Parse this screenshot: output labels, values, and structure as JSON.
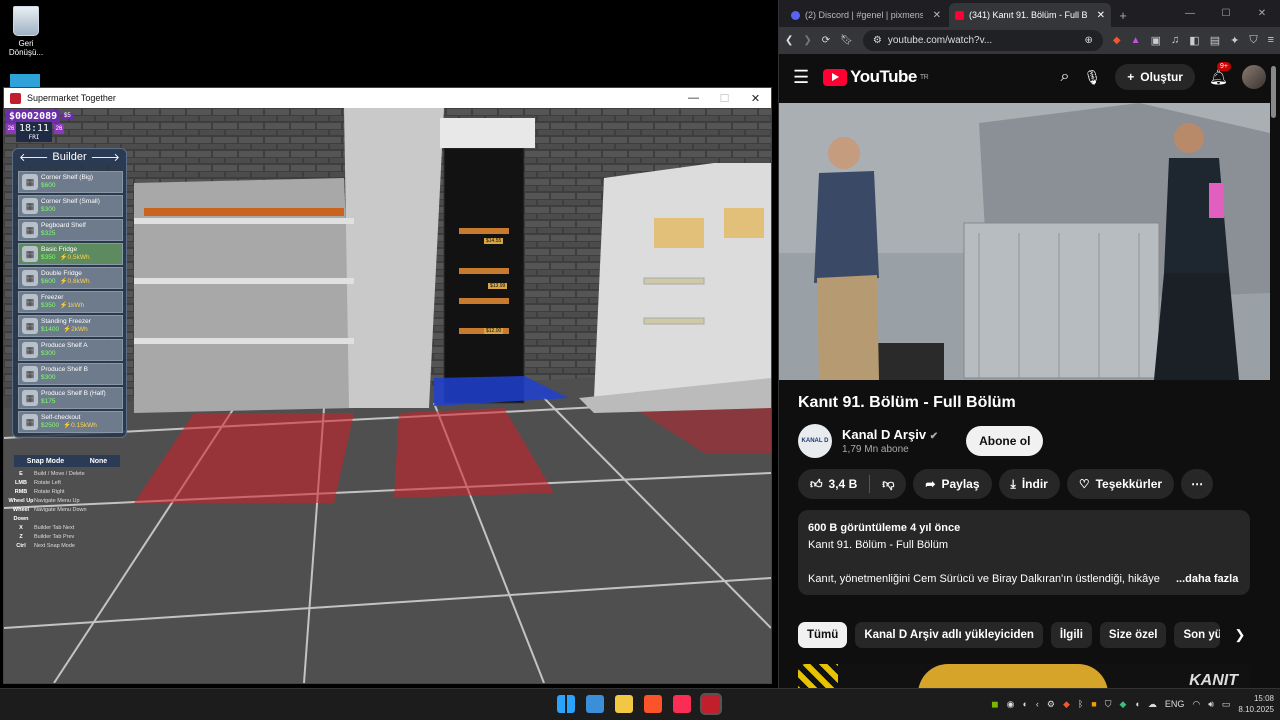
{
  "desktop": {
    "recycle_label": "Geri\nDönüşü..."
  },
  "game": {
    "window_title": "Supermarket Together",
    "money": "$0002089",
    "money_sub": "$5",
    "time": "18:11",
    "day": "FRI",
    "side_left": "26",
    "side_right": "26",
    "builder_title": "Builder",
    "items": [
      {
        "name": "Corner Shelf (Big)",
        "price": "$600",
        "power": ""
      },
      {
        "name": "Corner Shelf (Small)",
        "price": "$300",
        "power": ""
      },
      {
        "name": "Pegboard Shelf",
        "price": "$325",
        "power": ""
      },
      {
        "name": "Basic Fridge",
        "price": "$350",
        "power": "⚡0.5kWh"
      },
      {
        "name": "Double Fridge",
        "price": "$600",
        "power": "⚡0.8kWh"
      },
      {
        "name": "Freezer",
        "price": "$350",
        "power": "⚡1kWh"
      },
      {
        "name": "Standing Freezer",
        "price": "$1400",
        "power": "⚡2kWh"
      },
      {
        "name": "Produce Shelf A",
        "price": "$300",
        "power": ""
      },
      {
        "name": "Produce Shelf B",
        "price": "$300",
        "power": ""
      },
      {
        "name": "Produce Shelf B (Half)",
        "price": "$175",
        "power": ""
      },
      {
        "name": "Self-checkout",
        "price": "$2500",
        "power": "⚡0.15kWh"
      }
    ],
    "snap_label": "Snap Mode",
    "snap_value": "None",
    "keys": [
      {
        "key": "E",
        "action": "Build / Move / Delete"
      },
      {
        "key": "LMB",
        "action": "Rotate Left"
      },
      {
        "key": "RMB",
        "action": "Rotate Right"
      },
      {
        "key": "Wheel Up",
        "action": "Navigate Menu Up"
      },
      {
        "key": "Wheel Down",
        "action": "Navigate Menu Down"
      },
      {
        "key": "X",
        "action": "Builder Tab Next"
      },
      {
        "key": "Z",
        "action": "Builder Tab Prev"
      },
      {
        "key": "Ctrl",
        "action": "Next Snap Mode"
      }
    ],
    "price_tags": [
      "$14.55",
      "$13.99",
      "$12.00"
    ]
  },
  "browser": {
    "tabs": [
      {
        "label": "(2) Discord | #genel | pixmens",
        "active": false
      },
      {
        "label": "(341) Kanıt 91. Bölüm - Full B",
        "active": true
      }
    ],
    "url": "youtube.com/watch?v...",
    "yt": {
      "logo": "YouTube",
      "region": "TR",
      "create": "Oluştur",
      "notif_badge": "9+",
      "video_title": "Kanıt 91. Bölüm - Full Bölüm",
      "channel_name": "Kanal D Arşiv",
      "channel_avatar": "KANAL D",
      "subs": "1,79 Mn abone",
      "subscribe": "Abone ol",
      "likes": "3,4 B",
      "share": "Paylaş",
      "download": "İndir",
      "thanks": "Teşekkürler",
      "views_line": "600 B görüntüleme  4 yıl önce",
      "desc_title": "Kanıt 91. Bölüm - Full Bölüm",
      "desc_text": "Kanıt, yönetmenliğini Cem Sürücü ve Biray Dalkıran'ın üstlendiği, hikâye",
      "more": "...daha fazla",
      "chips": [
        "Tümü",
        "Kanal D Arşiv adlı yükleyiciden",
        "İlgili",
        "Size özel",
        "Son yü"
      ],
      "thumb_text": "KANIT"
    }
  },
  "taskbar": {
    "time": "15:08",
    "date": "8.10.2025"
  }
}
